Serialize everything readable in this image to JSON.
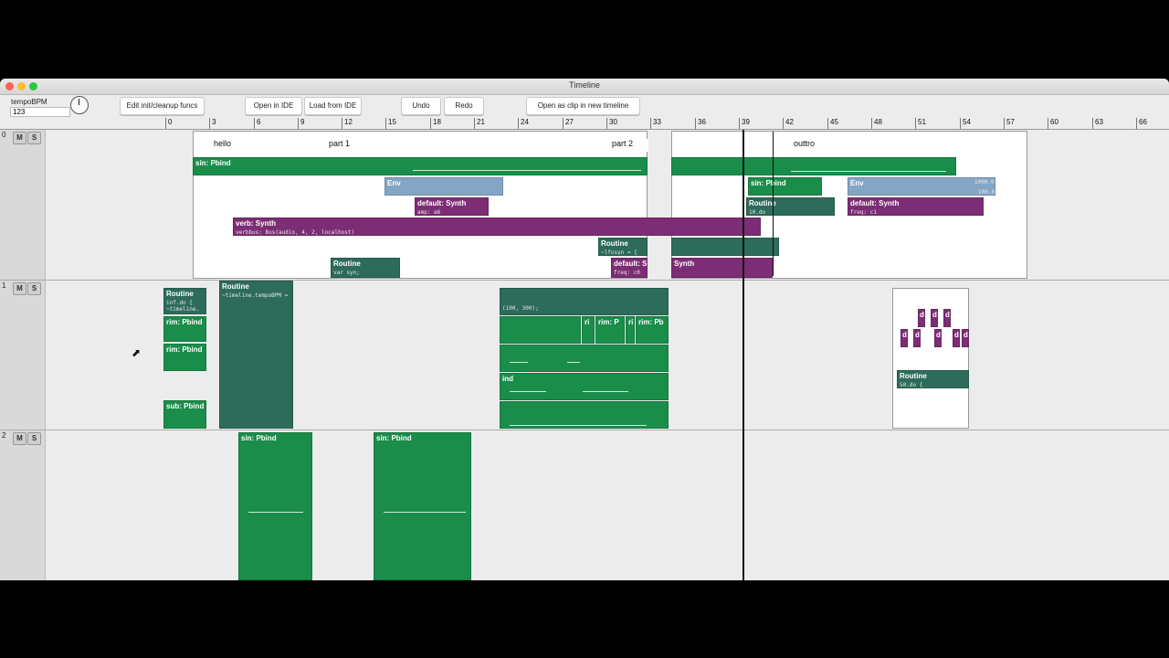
{
  "window": {
    "title": "Timeline"
  },
  "toolbar": {
    "tempo_label": "tempoBPM",
    "tempo_value": "123",
    "buttons": {
      "edit_funcs": "Edit init/cleanup funcs",
      "open_ide": "Open in IDE",
      "load_ide": "Load from IDE",
      "undo": "Undo",
      "redo": "Redo",
      "open_clip": "Open as clip in new timeline"
    }
  },
  "ruler": {
    "ticks": [
      "0",
      "3",
      "6",
      "9",
      "12",
      "15",
      "18",
      "21",
      "24",
      "27",
      "30",
      "33",
      "36",
      "39",
      "42",
      "45",
      "48",
      "51",
      "54",
      "57",
      "60",
      "63",
      "66"
    ]
  },
  "tracks": [
    {
      "index": "0",
      "mute": "M",
      "solo": "S"
    },
    {
      "index": "1",
      "mute": "M",
      "solo": "S"
    },
    {
      "index": "2",
      "mute": "M",
      "solo": "S"
    }
  ],
  "track0": {
    "sections": {
      "hello": "hello",
      "part1": "part 1",
      "part2": "part 2",
      "outro": "outtro"
    },
    "clips": {
      "sin_pbind": "sin: Pbind",
      "env1": "Env",
      "default_synth1": "default: Synth",
      "default_synth1_args": "amp:  a6",
      "verb_synth": "verb: Synth",
      "verb_args": "verbbus:  Bus(audio, 4, 2, localhost)",
      "routine_lfo": "Routine",
      "routine_lfo_code": "~lfosyn = {",
      "routine_var": "Routine",
      "routine_var_code": "var syn;",
      "default_synth2": "default: S",
      "default_synth2_args": "freq:  c0",
      "synth_tail": "Synth",
      "sin_pbind2": "sin: Pbind",
      "routine_10": "Routine",
      "routine_10_code": "10.do",
      "env2": "Env",
      "env2_val_top": "1000.0",
      "env2_val_bot": "100.0",
      "default_synth3": "default: Synth",
      "default_synth3_args": "freq:  c1"
    }
  },
  "track1": {
    "clips": {
      "routine_inf": "Routine",
      "routine_inf_code": "inf.do {",
      "routine_inf_code2": "~timeline.",
      "rim1": "rim: Pbind",
      "rim2": "rim: Pbind",
      "sub": "sub: Pbind",
      "routine_tempo": "Routine",
      "routine_tempo_code": "~timeline.tempoBPM =",
      "nested_code": "(100, 300);",
      "nested_ri1": "ri",
      "nested_rimp": "rim: P",
      "nested_ri2": "ri",
      "nested_rimpb": "rim: Pb",
      "nested_ind": "ind",
      "routine_50": "Routine",
      "routine_50_code": "50.do {",
      "d_label": "d"
    }
  },
  "track2": {
    "clips": {
      "sin1": "sin: Pbind",
      "sin2": "sin: Pbind"
    }
  }
}
